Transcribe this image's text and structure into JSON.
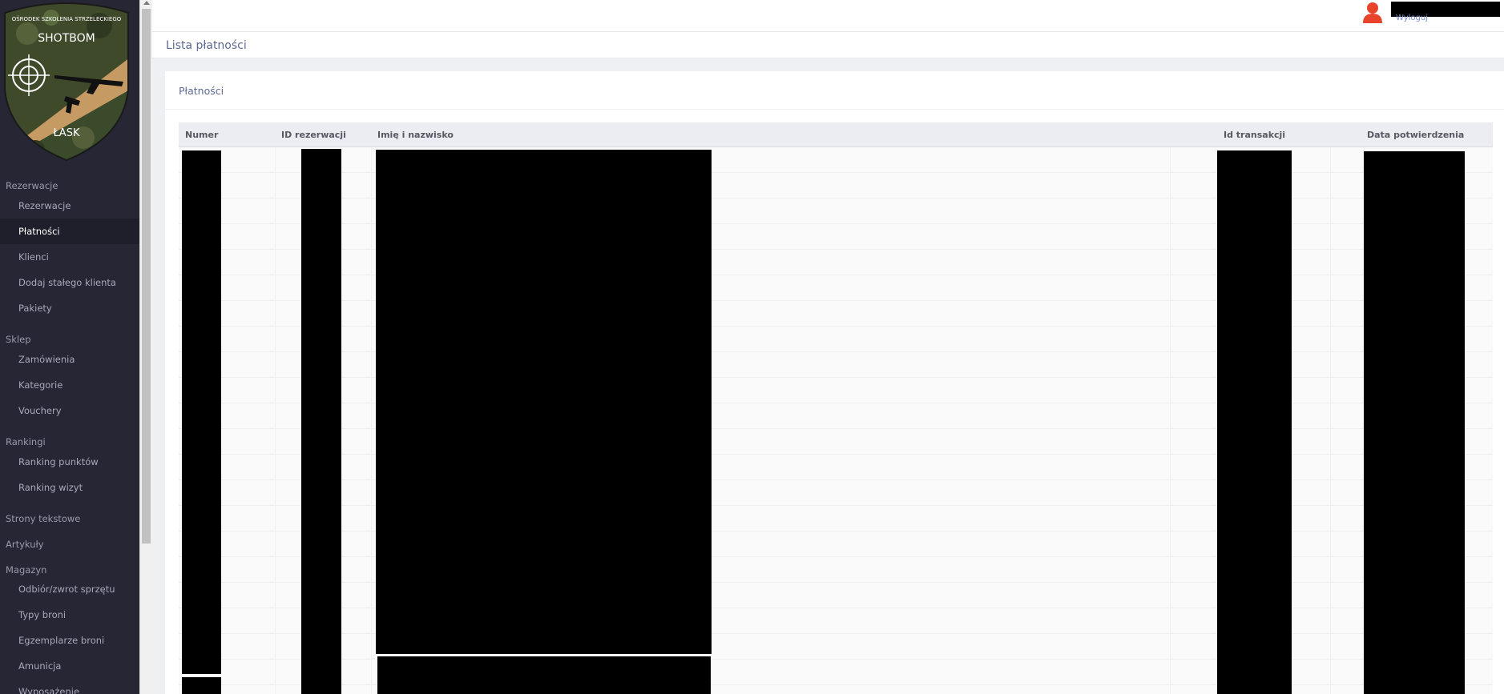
{
  "logo": {
    "arc_text": "OŚRODEK SZKOLENIA STRZELECKIEGO",
    "name": "SHOTBOM",
    "city": "ŁASK"
  },
  "sidebar": {
    "groups": [
      {
        "label": "Rezerwacje",
        "items": [
          "Rezerwacje",
          "Płatności",
          "Klienci",
          "Dodaj stałego klienta",
          "Pakiety"
        ]
      },
      {
        "label": "Sklep",
        "items": [
          "Zamówienia",
          "Kategorie",
          "Vouchery"
        ]
      },
      {
        "label": "Rankingi",
        "items": [
          "Ranking punktów",
          "Ranking wizyt"
        ]
      },
      {
        "label": "Strony tekstowe",
        "items": []
      },
      {
        "label": "Artykuły",
        "items": []
      },
      {
        "label": "Magazyn",
        "items": [
          "Odbiór/zwrot sprzętu",
          "Typy broni",
          "Egzemplarze broni",
          "Amunicja",
          "Wyposażenie"
        ]
      }
    ],
    "active_item": "Płatności"
  },
  "header": {
    "logout_label": "Wyloguj",
    "accent_color": "#e8442c"
  },
  "page": {
    "title": "Lista płatności"
  },
  "card": {
    "title": "Płatności"
  },
  "table": {
    "columns": [
      "Numer",
      "ID rezerwacji",
      "Imię i nazwisko",
      "Id transakcji",
      "Data potwierdzenia"
    ],
    "row_count": 22
  }
}
